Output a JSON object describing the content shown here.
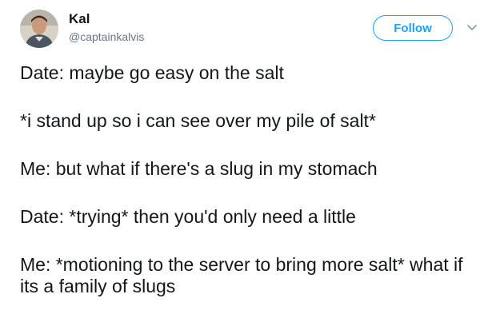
{
  "user": {
    "display_name": "Kal",
    "handle": "@captainkalvis"
  },
  "follow_button": {
    "label": "Follow"
  },
  "tweet": {
    "lines": [
      "Date: maybe go easy on the salt",
      "*i stand up so i can see over my pile of salt*",
      "Me: but what if there's a slug in my stomach",
      "Date: *trying* then you'd only need a little",
      "Me: *motioning to the server to bring more salt* what if its a family of slugs"
    ]
  },
  "colors": {
    "accent": "#1da1f2",
    "text": "#14171a",
    "secondary_text": "#657786"
  },
  "icons": {
    "menu": "chevron-down-icon"
  }
}
